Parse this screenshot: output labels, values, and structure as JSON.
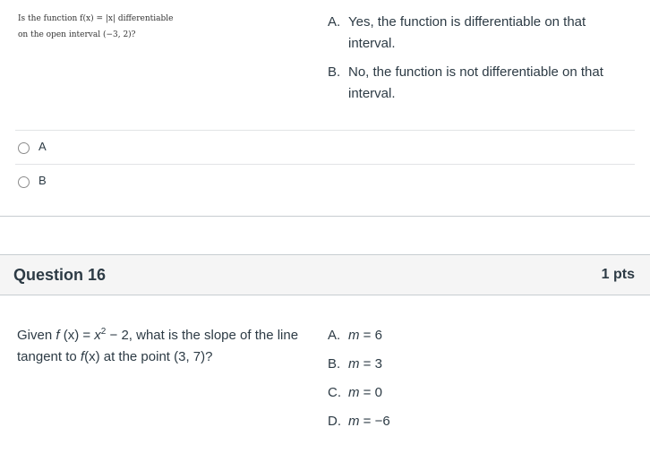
{
  "prev_question": {
    "image_text": {
      "line1": "Is the function f(x) = |x| differentiable",
      "line2": "on the open interval (−3, 2)?"
    },
    "choices": [
      {
        "letter": "A.",
        "text": "Yes, the function is differentiable on that interval."
      },
      {
        "letter": "B.",
        "text": "No, the function is not differentiable on that interval."
      }
    ],
    "answers": [
      {
        "label": "A"
      },
      {
        "label": "B"
      }
    ]
  },
  "question16": {
    "title": "Question 16",
    "points": "1 pts",
    "text": {
      "part1": "Given ",
      "f": "f",
      "part2": " (x) = ",
      "x": "x",
      "exp": "2",
      "part3": " − 2, what is the slope of the line tangent to ",
      "f2": "f",
      "part4": "(x) at the point (3, 7)?"
    },
    "choices": [
      {
        "letter": "A.",
        "var": "m",
        "value": " = 6"
      },
      {
        "letter": "B.",
        "var": "m",
        "value": " = 3"
      },
      {
        "letter": "C.",
        "var": "m",
        "value": " = 0"
      },
      {
        "letter": "D.",
        "var": "m",
        "value": " = −6"
      }
    ]
  }
}
